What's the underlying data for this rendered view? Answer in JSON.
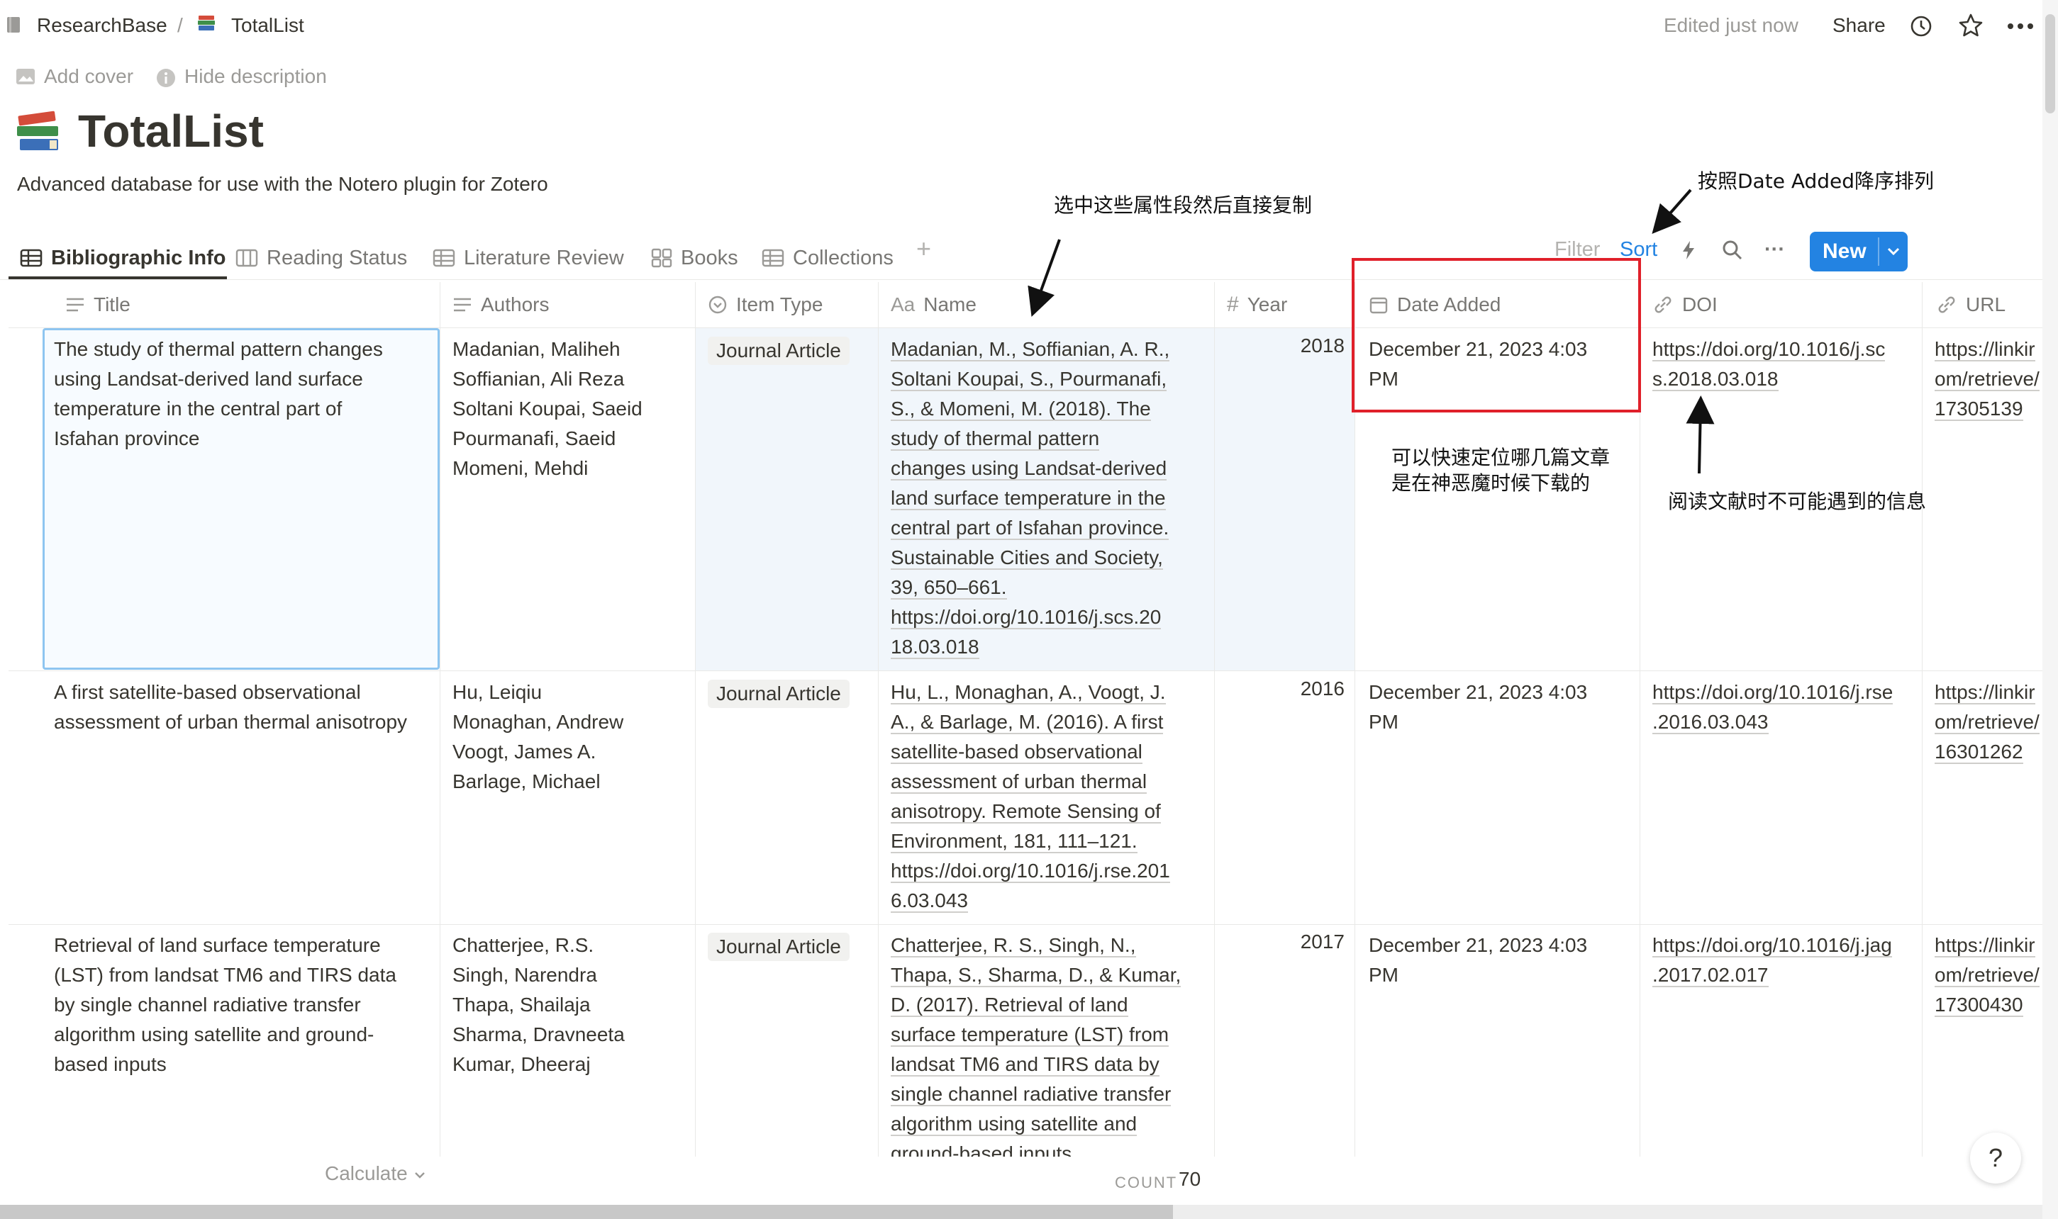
{
  "breadcrumb": {
    "workspace": "ResearchBase",
    "separator": "/",
    "page": "TotalList"
  },
  "topbar": {
    "edited": "Edited just now",
    "share": "Share"
  },
  "header": {
    "add_cover": "Add cover",
    "hide_description": "Hide description",
    "title": "TotalList",
    "description": "Advanced database for use with the Notero plugin for Zotero"
  },
  "tabs": [
    {
      "label": "Bibliographic Info",
      "active": true
    },
    {
      "label": "Reading Status"
    },
    {
      "label": "Literature Review"
    },
    {
      "label": "Books"
    },
    {
      "label": "Collections"
    }
  ],
  "add_view": "+",
  "toolbar": {
    "filter": "Filter",
    "sort": "Sort",
    "more": "···",
    "new": "New"
  },
  "columns": {
    "title": "Title",
    "authors": "Authors",
    "item_type": "Item Type",
    "name_prefix": "Aa",
    "name": "Name",
    "year": "Year",
    "date_added": "Date Added",
    "doi": "DOI",
    "url": "URL"
  },
  "rows": [
    {
      "title": [
        "The study of thermal pattern changes",
        "using Landsat-derived land surface",
        "temperature in the central part of",
        "Isfahan province"
      ],
      "authors": [
        "Madanian, Maliheh",
        "Soffianian, Ali Reza",
        "Soltani Koupai, Saeid",
        "Pourmanafi, Saeid",
        "Momeni, Mehdi"
      ],
      "item_type": "Journal Article",
      "name": [
        "Madanian, M., Soffianian, A. R.,",
        "Soltani Koupai, S., Pourmanafi,",
        "S., & Momeni, M. (2018). The",
        "study of thermal pattern",
        "changes using Landsat-derived",
        "land surface temperature in the",
        "central part of Isfahan province.",
        "Sustainable Cities and Society,",
        "39, 650–661.",
        "https://doi.org/10.1016/j.scs.20",
        "18.03.018"
      ],
      "year": "2018",
      "date_added": [
        "December 21, 2023 4:03",
        "PM"
      ],
      "doi": [
        "https://doi.org/10.1016/j.sc",
        "s.2018.03.018"
      ],
      "url": [
        "https://linkir",
        "om/retrieve/",
        "17305139"
      ]
    },
    {
      "title": [
        "A first satellite-based observational",
        "assessment of urban thermal anisotropy"
      ],
      "authors": [
        "Hu, Leiqiu",
        "Monaghan, Andrew",
        "Voogt, James A.",
        "Barlage, Michael"
      ],
      "item_type": "Journal Article",
      "name": [
        "Hu, L., Monaghan, A., Voogt, J.",
        "A., & Barlage, M. (2016). A first",
        "satellite-based observational",
        "assessment of urban thermal",
        "anisotropy. Remote Sensing of",
        "Environment, 181, 111–121.",
        "https://doi.org/10.1016/j.rse.201",
        "6.03.043"
      ],
      "year": "2016",
      "date_added": [
        "December 21, 2023 4:03",
        "PM"
      ],
      "doi": [
        "https://doi.org/10.1016/j.rse",
        ".2016.03.043"
      ],
      "url": [
        "https://linkir",
        "om/retrieve/",
        "16301262"
      ]
    },
    {
      "title": [
        "Retrieval of land surface temperature",
        "(LST) from landsat TM6 and TIRS data",
        "by single channel radiative transfer",
        "algorithm using satellite and ground-",
        "based inputs"
      ],
      "authors": [
        "Chatterjee, R.S.",
        "Singh, Narendra",
        "Thapa, Shailaja",
        "Sharma, Dravneeta",
        "Kumar, Dheeraj"
      ],
      "item_type": "Journal Article",
      "name": [
        "Chatterjee, R. S., Singh, N.,",
        "Thapa, S., Sharma, D., & Kumar,",
        "D. (2017). Retrieval of land",
        "surface temperature (LST) from",
        "landsat TM6 and TIRS data by",
        "single channel radiative transfer",
        "algorithm using satellite and",
        "ground-based inputs."
      ],
      "year": "2017",
      "date_added": [
        "December 21, 2023 4:03",
        "PM"
      ],
      "doi": [
        "https://doi.org/10.1016/j.jag",
        ".2017.02.017"
      ],
      "url": [
        "https://linkir",
        "om/retrieve/",
        "17300430"
      ]
    }
  ],
  "footer": {
    "calculate": "Calculate",
    "count_label": "COUNT",
    "count_value": "70",
    "help": "?"
  },
  "annotations": {
    "copy_fields": "选中这些属性段然后直接复制",
    "sort_desc": "按照Date Added降序排列",
    "locate_1": "可以快速定位哪几篇文章",
    "locate_2": "是在神恶魔时候下载的",
    "info": "阅读文献时不可能遇到的信息"
  },
  "colors": {
    "accent": "#2383e2",
    "annotation_box": "#e0202a",
    "selection": "#8ec5f0"
  }
}
